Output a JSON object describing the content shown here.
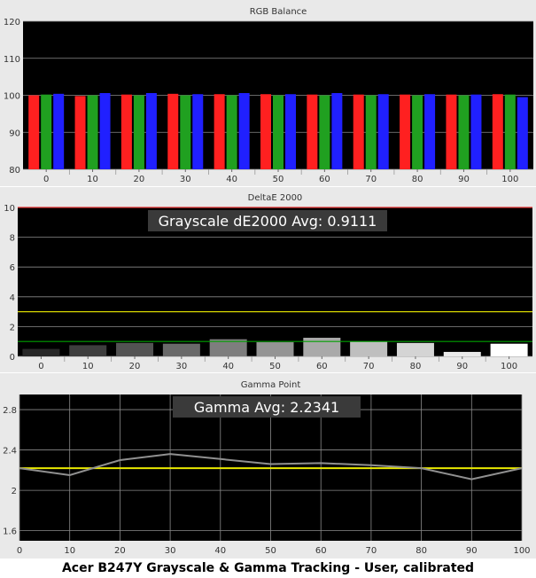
{
  "caption": "Acer B247Y Grayscale & Gamma Tracking - User, calibrated",
  "chart_data": [
    {
      "type": "bar",
      "title": "RGB Balance",
      "categories": [
        "0",
        "10",
        "20",
        "30",
        "40",
        "50",
        "60",
        "70",
        "80",
        "90",
        "100"
      ],
      "ylim": [
        80,
        120
      ],
      "yticks": [
        80,
        90,
        100,
        110,
        120
      ],
      "grid": true,
      "series": [
        {
          "color": "#ff2020",
          "values": [
            100,
            99.8,
            100.2,
            100.4,
            100.3,
            100.3,
            100.2,
            100.2,
            100.2,
            100.2,
            100.3
          ]
        },
        {
          "color": "#20a020",
          "values": [
            100.2,
            100,
            100,
            100,
            100,
            100,
            100,
            100,
            100,
            100,
            100.2
          ]
        },
        {
          "color": "#2020ff",
          "values": [
            100.4,
            100.6,
            100.6,
            100.3,
            100.6,
            100.3,
            100.6,
            100.3,
            100.3,
            100.2,
            99.5
          ]
        }
      ]
    },
    {
      "type": "bar",
      "title": "DeltaE 2000",
      "annotation": "Grayscale dE2000 Avg: 0.9111",
      "categories": [
        "0",
        "10",
        "20",
        "30",
        "40",
        "50",
        "60",
        "70",
        "80",
        "90",
        "100"
      ],
      "values": [
        0.5,
        0.75,
        0.9,
        0.85,
        1.15,
        0.95,
        1.25,
        1.0,
        0.9,
        0.3,
        0.85
      ],
      "ylim": [
        0,
        10
      ],
      "yticks": [
        0,
        2,
        4,
        6,
        8,
        10
      ],
      "thresholds": [
        {
          "value": 10,
          "color": "#e03030"
        },
        {
          "value": 3,
          "color": "#d8d800"
        },
        {
          "value": 1,
          "color": "#00a000"
        }
      ],
      "grid": true
    },
    {
      "type": "line",
      "title": "Gamma Point",
      "annotation": "Gamma Avg: 2.2341",
      "x": [
        0,
        10,
        20,
        30,
        40,
        50,
        60,
        70,
        80,
        90,
        100
      ],
      "y": [
        2.22,
        2.15,
        2.3,
        2.36,
        2.31,
        2.26,
        2.27,
        2.25,
        2.22,
        2.11,
        2.22
      ],
      "xticks": [
        0,
        10,
        20,
        30,
        40,
        50,
        60,
        70,
        80,
        90,
        100
      ],
      "yticks": [
        1.6,
        2.0,
        2.4,
        2.8
      ],
      "xlim": [
        0,
        100
      ],
      "ylim": [
        1.5,
        2.95
      ],
      "target": 2.22,
      "target_color": "#e8e800",
      "line_color": "#909090",
      "grid": true
    }
  ]
}
